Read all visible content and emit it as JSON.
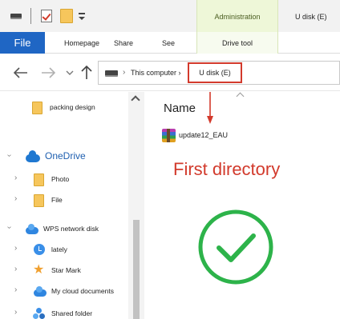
{
  "ribbon": {
    "context_group": "Administration",
    "window_title": "U disk  (E)",
    "tabs": {
      "file": "File",
      "homepage": "Homepage",
      "share": "Share",
      "see": "See",
      "drive_tool": "Drive tool"
    }
  },
  "address": {
    "computer": "This computer",
    "udisk": "U disk  (E)"
  },
  "sidebar": {
    "items": [
      {
        "label": "packing design",
        "icon": "folder-icon"
      },
      {
        "label": "OneDrive",
        "icon": "onedrive-cloud-icon"
      },
      {
        "label": "Photo",
        "icon": "folder-icon"
      },
      {
        "label": "File",
        "icon": "folder-icon"
      },
      {
        "label": "WPS network disk",
        "icon": "wps-cloud-icon"
      },
      {
        "label": "lately",
        "icon": "clock-icon"
      },
      {
        "label": "Star Mark",
        "icon": "star-icon"
      },
      {
        "label": "My cloud documents",
        "icon": "cloud-icon"
      },
      {
        "label": "Shared folder",
        "icon": "shared-folder-icon"
      }
    ]
  },
  "main": {
    "column_header": "Name",
    "file_name": "update12_EAU",
    "annotation": "First directory"
  },
  "colors": {
    "file_tab": "#1f66c4",
    "highlight_red": "#d33a2c",
    "check_green": "#2db34a",
    "context_tab_bg": "#eef7d8"
  }
}
